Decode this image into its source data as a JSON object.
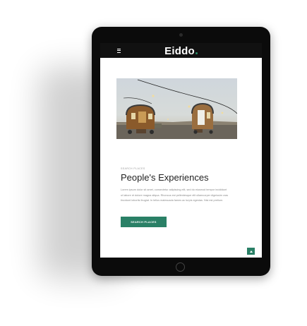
{
  "header": {
    "logo_text": "Eiddo",
    "logo_dot_color": "#2a8a66",
    "menu_icon": "hamburger-icon"
  },
  "hero": {
    "image_alt": "wooden tiny wagons under string lights"
  },
  "content": {
    "eyebrow": "Search Places",
    "title": "People's Experiences",
    "body": "Lorem ipsum dolor sit amet, consectetur adipiscing elit, sed do eiusmod tempor incididunt ut labore et dolore magna aliqua. Rhoncus est pellentesque elit ullamcorper dignissim cras tincidunt lobortis feugiat. In tellus malesuada fames ac turpis egestas. Nisi est pretium.",
    "button_label": "Search Places"
  },
  "colors": {
    "accent": "#2a8066",
    "topbar": "#111111",
    "device": "#0b0b0b"
  },
  "scroll_top_icon": "chevron-up-icon"
}
